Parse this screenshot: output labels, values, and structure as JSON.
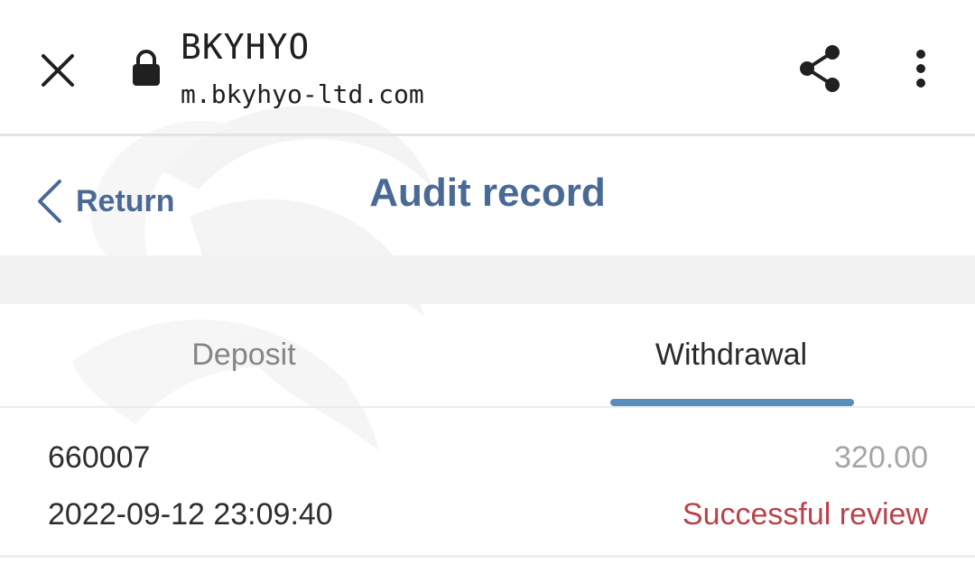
{
  "browser": {
    "site_title": "BKYHYO",
    "site_url": "m.bkyhyo-ltd.com",
    "icons": {
      "close": "close-icon",
      "lock": "lock-icon",
      "share": "share-icon",
      "more": "more-vertical-icon"
    }
  },
  "header": {
    "return_label": "Return",
    "title": "Audit record"
  },
  "tabs": [
    {
      "label": "Deposit",
      "active": false
    },
    {
      "label": "Withdrawal",
      "active": true
    }
  ],
  "records": [
    {
      "id": "660007",
      "amount": "320.00",
      "time": "2022-09-12 23:09:40",
      "status": "Successful review"
    }
  ],
  "colors": {
    "accent": "#4a6a96",
    "tab_indicator": "#5a8dbd",
    "status_success": "#b9424a",
    "amount": "#a5a5a5"
  }
}
